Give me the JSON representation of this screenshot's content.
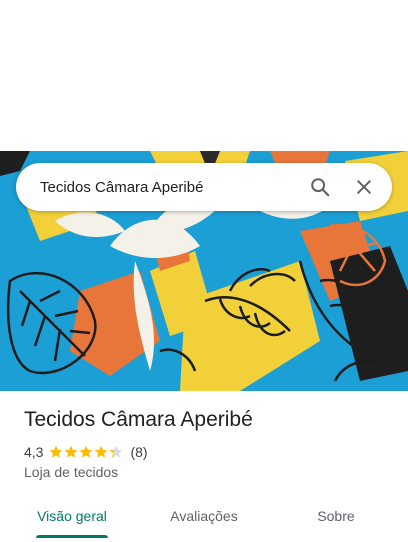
{
  "search": {
    "query": "Tecidos Câmara Aperibé"
  },
  "place": {
    "name": "Tecidos Câmara Aperibé",
    "rating": "4,3",
    "stars_value": 4.3,
    "reviews_count": "(8)",
    "category": "Loja de tecidos"
  },
  "tabs": [
    {
      "label": "Visão geral",
      "active": true
    },
    {
      "label": "Avaliações",
      "active": false
    },
    {
      "label": "Sobre",
      "active": false
    }
  ],
  "colors": {
    "accent": "#00796b",
    "star": "#fbbc04",
    "star_empty": "#dadce0"
  },
  "icons": {
    "search": "search-icon",
    "close": "close-icon"
  }
}
